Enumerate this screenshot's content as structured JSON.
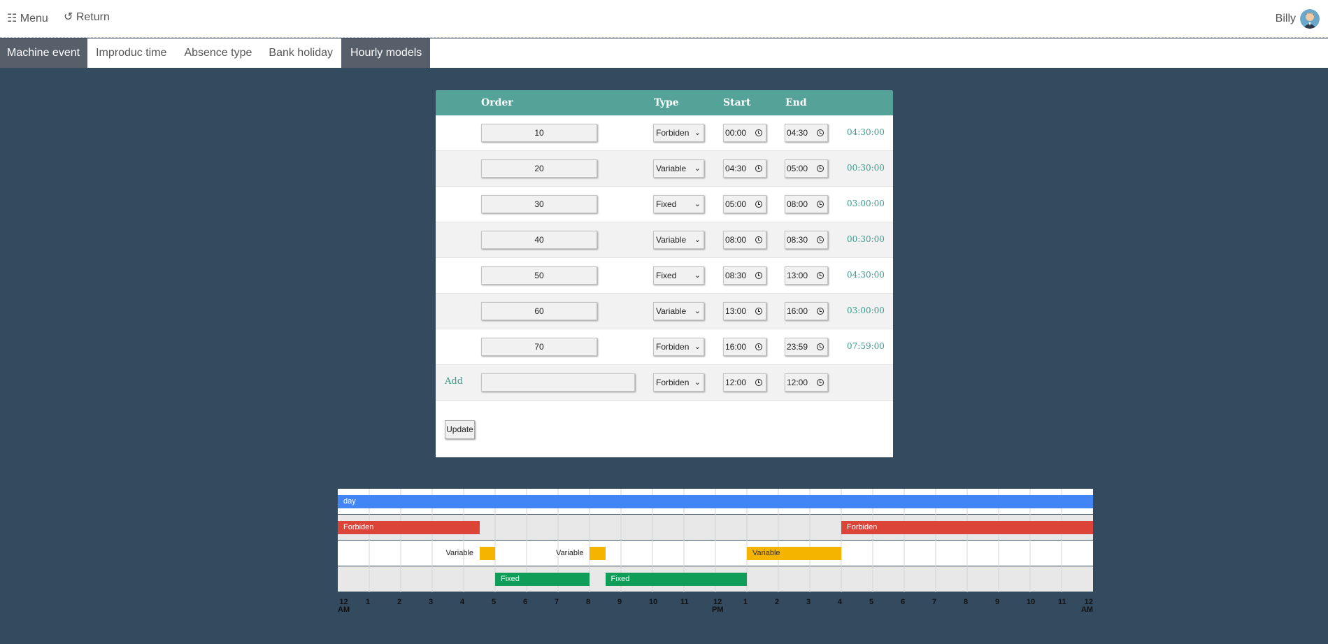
{
  "topbar": {
    "menu_icon": "grid-menu-icon",
    "menu_label": "☷ Menu",
    "return_label": "↺ Return",
    "user_name": "Billy"
  },
  "tabs": [
    {
      "label": "Machine event",
      "active": true
    },
    {
      "label": "Improduc time",
      "active": false
    },
    {
      "label": "Absence type",
      "active": false
    },
    {
      "label": "Bank holiday",
      "active": false
    },
    {
      "label": "Hourly models",
      "active": true
    }
  ],
  "table": {
    "headers": {
      "order": "Order",
      "type": "Type",
      "start": "Start",
      "end": "End"
    },
    "rows": [
      {
        "order": "10",
        "type": "Forbiden",
        "start": "00:00",
        "end": "04:30",
        "duration": "04:30:00"
      },
      {
        "order": "20",
        "type": "Variable",
        "start": "04:30",
        "end": "05:00",
        "duration": "00:30:00"
      },
      {
        "order": "30",
        "type": "Fixed",
        "start": "05:00",
        "end": "08:00",
        "duration": "03:00:00"
      },
      {
        "order": "40",
        "type": "Variable",
        "start": "08:00",
        "end": "08:30",
        "duration": "00:30:00"
      },
      {
        "order": "50",
        "type": "Fixed",
        "start": "08:30",
        "end": "13:00",
        "duration": "04:30:00"
      },
      {
        "order": "60",
        "type": "Variable",
        "start": "13:00",
        "end": "16:00",
        "duration": "03:00:00"
      },
      {
        "order": "70",
        "type": "Forbiden",
        "start": "16:00",
        "end": "23:59",
        "duration": "07:59:00"
      }
    ],
    "add_row": {
      "label": "Add",
      "order": "",
      "type": "Forbiden",
      "start": "12:00",
      "end": "12:00"
    },
    "update_label": "Update"
  },
  "timeline": {
    "colors": {
      "day": "#4285f4",
      "Forbiden": "#db4437",
      "Variable": "#f4b400",
      "Fixed": "#0f9d58"
    },
    "bars": [
      {
        "lane": 0,
        "label": "day",
        "type": "day",
        "start": 0,
        "end": 24
      },
      {
        "lane": 1,
        "label": "Forbiden",
        "type": "Forbiden",
        "start": 0,
        "end": 4.5
      },
      {
        "lane": 1,
        "label": "Forbiden",
        "type": "Forbiden",
        "start": 16,
        "end": 24
      },
      {
        "lane": 2,
        "label": "Variable",
        "type": "Variable",
        "start": 4.5,
        "end": 5,
        "outside": true
      },
      {
        "lane": 2,
        "label": "Variable",
        "type": "Variable",
        "start": 8,
        "end": 8.5,
        "outside": true
      },
      {
        "lane": 2,
        "label": "Variable",
        "type": "Variable",
        "start": 13,
        "end": 16
      },
      {
        "lane": 3,
        "label": "Fixed",
        "type": "Fixed",
        "start": 5,
        "end": 8
      },
      {
        "lane": 3,
        "label": "Fixed",
        "type": "Fixed",
        "start": 8.5,
        "end": 13
      }
    ],
    "ticks": [
      "12\nAM",
      "1",
      "2",
      "3",
      "4",
      "5",
      "6",
      "7",
      "8",
      "9",
      "10",
      "11",
      "12\nPM",
      "1",
      "2",
      "3",
      "4",
      "5",
      "6",
      "7",
      "8",
      "9",
      "10",
      "11",
      "12\nAM"
    ]
  }
}
